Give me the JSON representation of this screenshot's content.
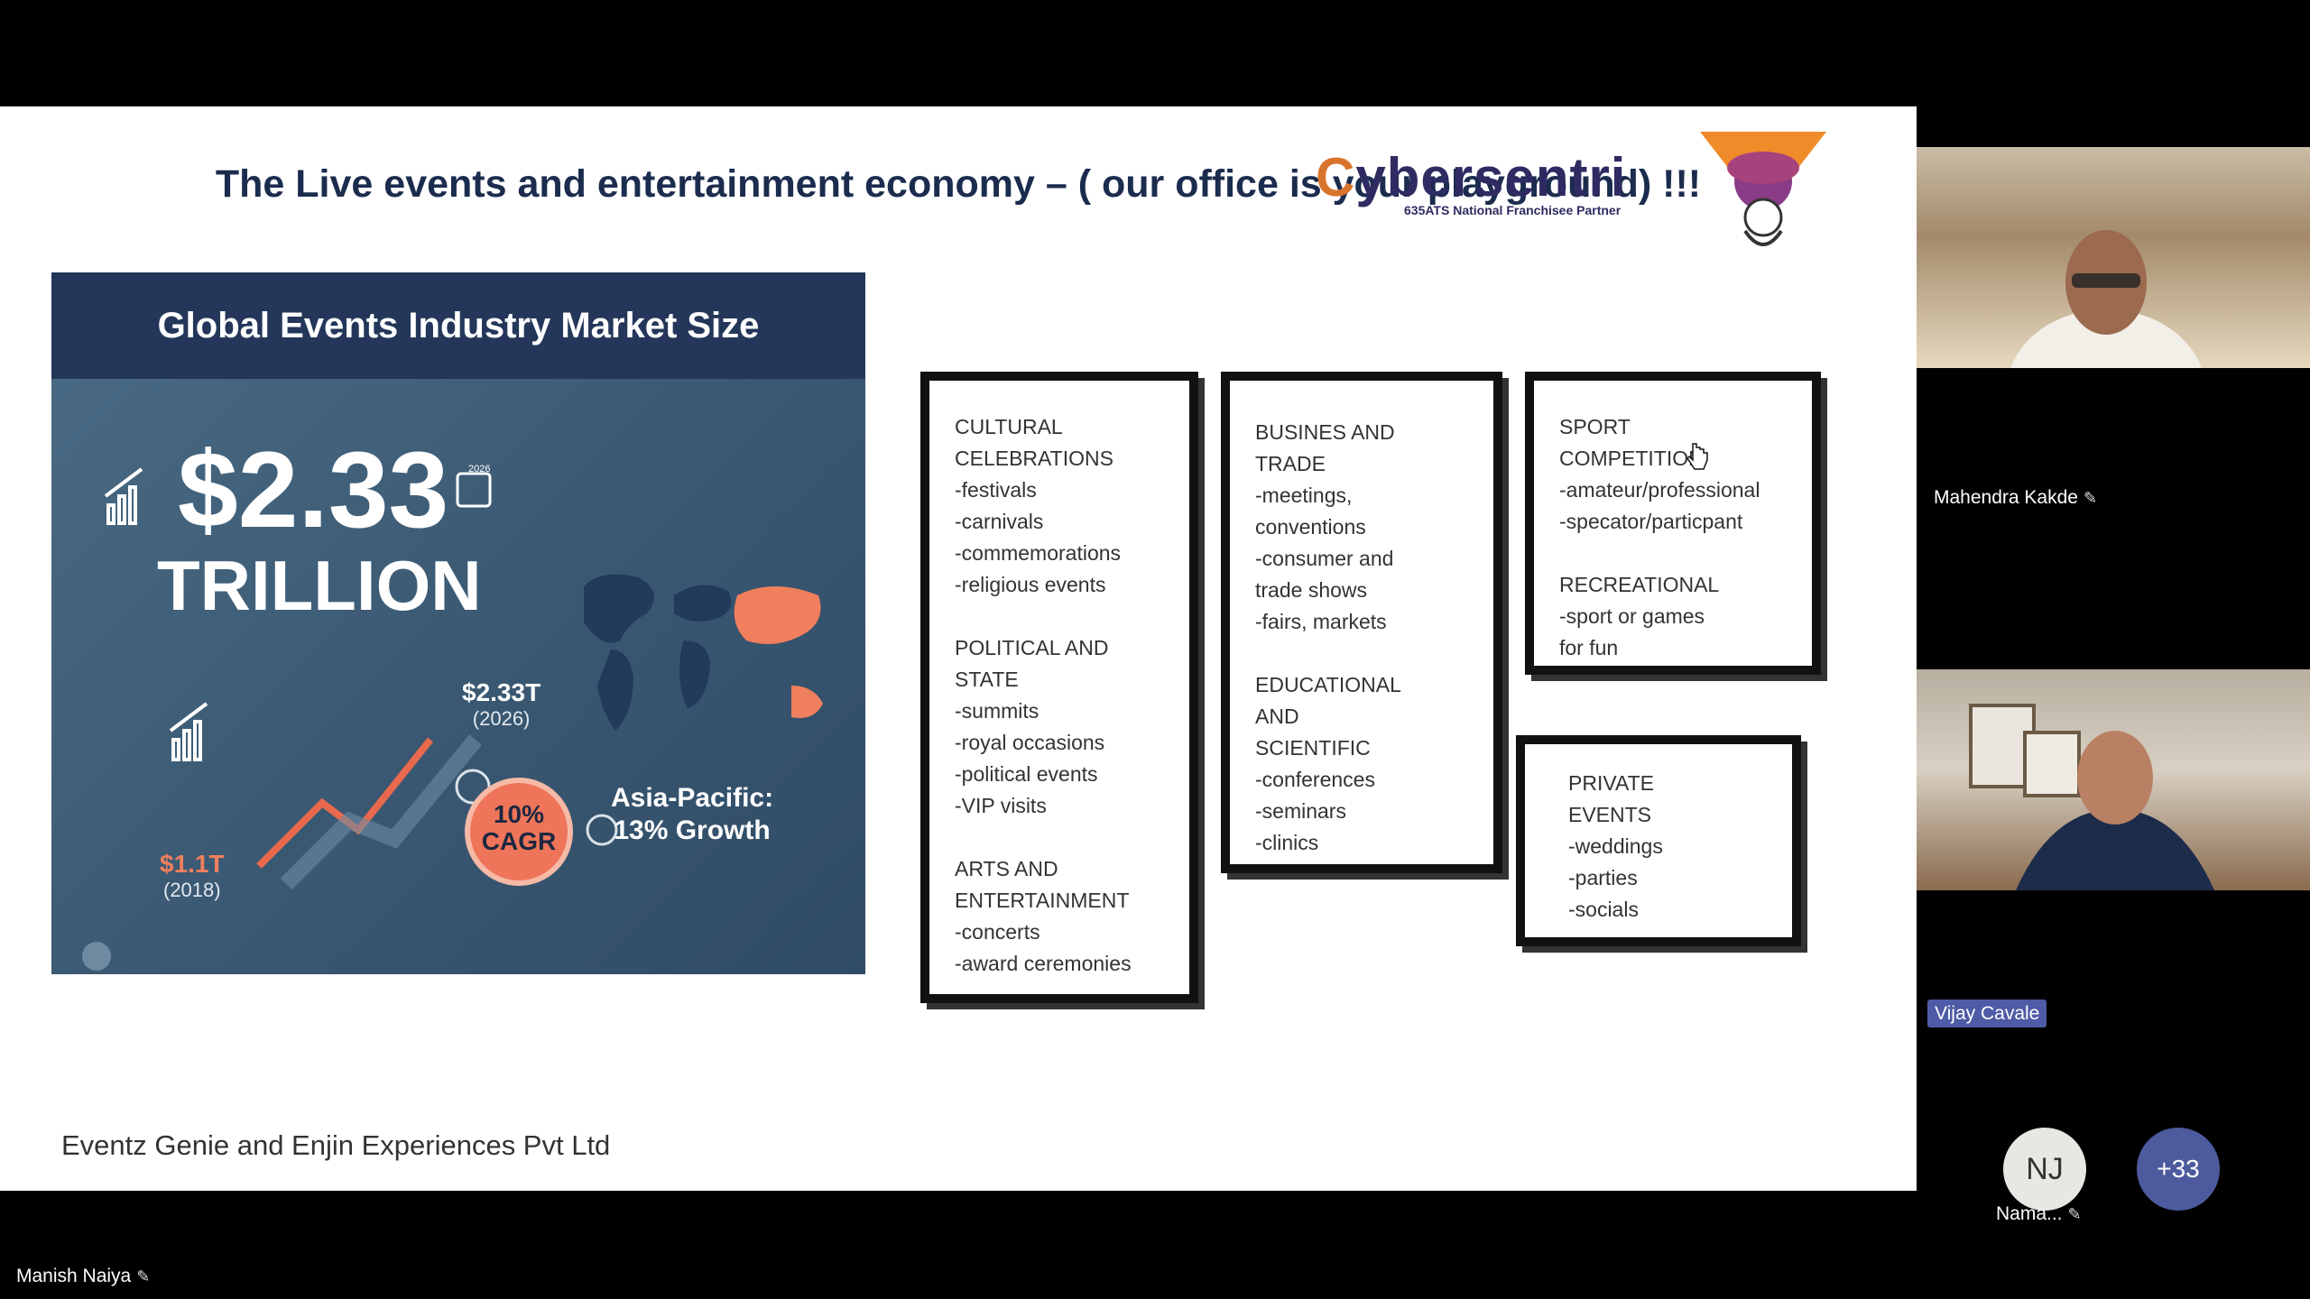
{
  "slide": {
    "title": "The Live events and entertainment economy – ( our office is your playground)  !!!",
    "logo_text_c": "C",
    "logo_text_rest": "ybersentri",
    "logo_subtext": "635ATS National Franchisee Partner",
    "infographic": {
      "title": "Global Events Industry Market Size",
      "big_value": "$2.33",
      "big_unit": "TRILLION",
      "value_2026": "$2.33T",
      "year_2026": "(2026)",
      "value_2018": "$1.1T",
      "year_2018": "(2018)",
      "cagr_line1": "10%",
      "cagr_line2": "CAGR",
      "apac_line1": "Asia-Pacific:",
      "apac_line2": "13% Growth",
      "calendar_label": "2026"
    },
    "boxes": {
      "cultural": "CULTURAL\nCELEBRATIONS\n-festivals\n-carnivals\n-commemorations\n-religious events\n\nPOLITICAL AND\nSTATE\n-summits\n-royal occasions\n-political events\n-VIP visits\n\nARTS AND\nENTERTAINMENT\n-concerts\n-award ceremonies",
      "business": "BUSINES AND\nTRADE\n-meetings,\n conventions\n-consumer and\n trade shows\n-fairs, markets\n\nEDUCATIONAL\nAND\nSCIENTIFIC\n-conferences\n-seminars\n-clinics",
      "sport": "SPORT\nCOMPETITION\n-amateur/professional\n-specator/particpant\n\nRECREATIONAL\n-sport or games\n for fun",
      "private": "PRIVATE\nEVENTS\n-weddings\n-parties\n-socials"
    },
    "footer": "Eventz Genie and Enjin Experiences Pvt Ltd"
  },
  "participants": {
    "presenter": "Manish Naiya",
    "p1": "Mahendra Kakde",
    "p2": "Vijay Cavale",
    "p3_initials": "NJ",
    "p3_name": "Nama...",
    "more_count": "+33"
  },
  "colors": {
    "slide_title": "#1b2c4e",
    "badge": "#4e5ba6",
    "cagr": "#ee7559"
  }
}
